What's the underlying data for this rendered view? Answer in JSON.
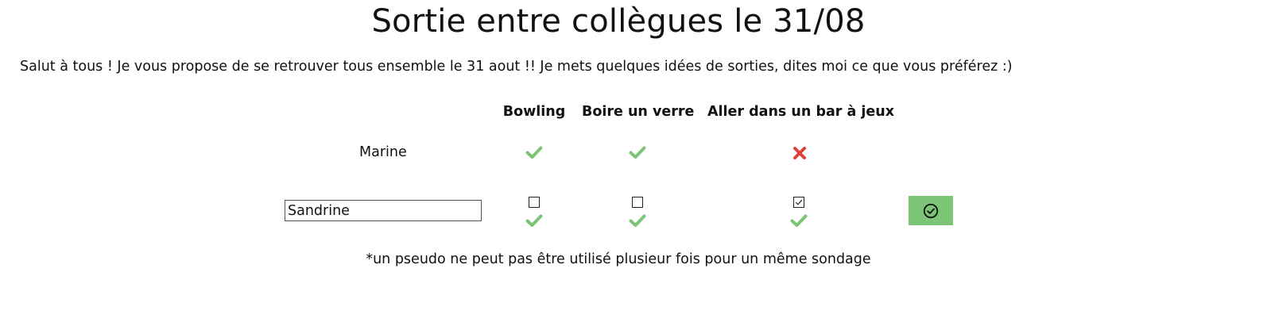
{
  "poll": {
    "title": "Sortie entre collègues le 31/08",
    "description": "Salut à tous ! Je vous propose de se retrouver tous ensemble le 31 aout !! Je mets quelques idées de sorties, dites moi ce que vous préférez :)",
    "options": [
      "Bowling",
      "Boire un verre",
      "Aller dans un bar à jeux"
    ]
  },
  "responses": [
    {
      "name": "Marine",
      "answers": [
        {
          "option": "Bowling",
          "icon": "check-icon",
          "color": "#7cc576"
        },
        {
          "option": "Boire un verre",
          "icon": "check-icon",
          "color": "#7cc576"
        },
        {
          "option": "Aller dans un bar à jeux",
          "icon": "cross-icon",
          "color": "#e0413a"
        }
      ]
    }
  ],
  "new_response": {
    "name_value": "Sandrine",
    "checked": [
      false,
      false,
      true
    ],
    "indicator_icon": "check-icon",
    "indicator_color": "#7cc576",
    "submit_icon": "check-circle-icon",
    "submit_color": "#7cc576"
  },
  "footnote": "*un pseudo ne peut pas être utilisé plusieur fois pour un même sondage"
}
